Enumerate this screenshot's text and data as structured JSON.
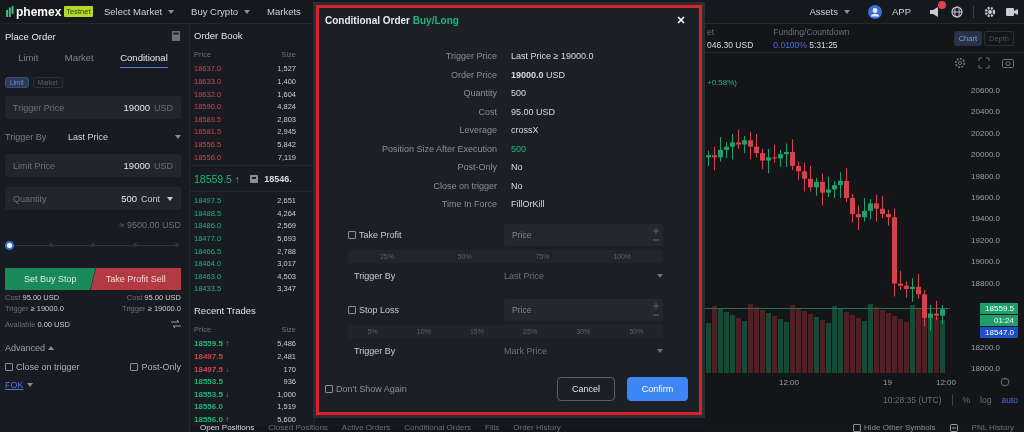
{
  "top_nav": {
    "logo": "phemex",
    "badge": "Testnet",
    "menus": [
      {
        "label": "Select Market",
        "dropdown": true
      },
      {
        "label": "Buy Crypto",
        "dropdown": true
      },
      {
        "label": "Markets",
        "dropdown": false
      }
    ],
    "assets": "Assets",
    "app": "APP"
  },
  "place_order": {
    "title": "Place Order",
    "tabs": [
      {
        "label": "Limit",
        "selected": false
      },
      {
        "label": "Market",
        "selected": false
      },
      {
        "label": "Conditional",
        "selected": true
      }
    ],
    "order_types": [
      {
        "label": "Limit",
        "selected": true
      },
      {
        "label": "Market",
        "selected": false
      }
    ],
    "trigger_price": {
      "label": "Trigger Price",
      "value": "19000",
      "unit": "USD"
    },
    "trigger_by": {
      "label": "Trigger By",
      "value": "Last Price"
    },
    "limit_price": {
      "label": "Limit Price",
      "value": "19000",
      "unit": "USD"
    },
    "quantity": {
      "label": "Quantity",
      "value": "500",
      "unit": "Cont"
    },
    "estimate": "≈ 9500.00 USD",
    "slider": {
      "level": 0
    },
    "buy_button": "Set Buy Stop",
    "sell_button": "Take Profit Sell",
    "buy_summary": [
      {
        "label": "Cost",
        "value": "95.00 USD"
      },
      {
        "label": "Trigger",
        "value": "≥ 19000.0"
      }
    ],
    "sell_summary": [
      {
        "label": "Cost",
        "value": "95.00 USD"
      },
      {
        "label": "Trigger",
        "value": "≥ 19000.0"
      }
    ],
    "available": {
      "label": "Available",
      "value": "0.00 USD"
    },
    "advanced": "Advanced",
    "options": [
      {
        "label": "Close on trigger",
        "checked": false
      },
      {
        "label": "Post-Only",
        "checked": false
      }
    ],
    "time_in_force": "FOK"
  },
  "order_book": {
    "title": "Order Book",
    "columns": [
      "Price",
      "Size"
    ],
    "asks": [
      {
        "price": "18637.0",
        "size": "1,527"
      },
      {
        "price": "18633.0",
        "size": "1,400"
      },
      {
        "price": "18632.0",
        "size": "1,604"
      },
      {
        "price": "18590.0",
        "size": "4,824"
      },
      {
        "price": "18589.5",
        "size": "2,803"
      },
      {
        "price": "18581.5",
        "size": "2,945"
      },
      {
        "price": "18556.5",
        "size": "5,842"
      },
      {
        "price": "18556.0",
        "size": "7,119"
      }
    ],
    "last_price": "18559.5 ↑",
    "mark_price": "18546.",
    "bids": [
      {
        "price": "18497.5",
        "size": "2,651"
      },
      {
        "price": "18488.5",
        "size": "4,264"
      },
      {
        "price": "18486.0",
        "size": "2,569"
      },
      {
        "price": "18477.0",
        "size": "5,693"
      },
      {
        "price": "18466.5",
        "size": "2,788"
      },
      {
        "price": "18464.0",
        "size": "3,017"
      },
      {
        "price": "18463.0",
        "size": "4,503"
      },
      {
        "price": "18433.5",
        "size": "3,347"
      }
    ]
  },
  "recent_trades": {
    "title": "Recent Trades",
    "columns": [
      "Price",
      "Size"
    ],
    "rows": [
      {
        "price": "18559.5 ↑",
        "size": "5,486",
        "color": "#1fb57a"
      },
      {
        "price": "18497.5",
        "size": "2,481",
        "color": "#d1434f"
      },
      {
        "price": "18497.5 ↓",
        "size": "170",
        "color": "#d1434f"
      },
      {
        "price": "18553.5",
        "size": "936",
        "color": "#1fb57a"
      },
      {
        "price": "18553.5 ↓",
        "size": "1,000",
        "color": "#1fb57a"
      },
      {
        "price": "18556.0",
        "size": "1,519",
        "color": "#1fb57a"
      },
      {
        "price": "18556.0 ↑",
        "size": "5,600",
        "color": "#1fb57a"
      }
    ]
  },
  "ticker": {
    "stat": {
      "label": "et",
      "value": "046.30 USD"
    },
    "funding": {
      "label": "Funding/Countdown",
      "rate": "0.0100%",
      "countdown": "5:31:25"
    },
    "views": [
      {
        "label": "Chart",
        "selected": true
      },
      {
        "label": "Depth",
        "selected": false
      }
    ]
  },
  "chart": {
    "change": "+0.58%)",
    "chart_data": {
      "type": "candlestick",
      "ylim": [
        18000,
        20600
      ],
      "yticks": [
        {
          "value": 20600,
          "label": "20600.0"
        },
        {
          "value": 20400,
          "label": "20400.0"
        },
        {
          "value": 20200,
          "label": "20200.0"
        },
        {
          "value": 20000,
          "label": "20000.0"
        },
        {
          "value": 19800,
          "label": "19800.0"
        },
        {
          "value": 19600,
          "label": "19600.0"
        },
        {
          "value": 19400,
          "label": "19400.0"
        },
        {
          "value": 19200,
          "label": "19200.0"
        },
        {
          "value": 19000,
          "label": "19000.0"
        },
        {
          "value": 18800,
          "label": "18800.0"
        },
        {
          "value": 18200,
          "label": "18200.0"
        },
        {
          "value": 18000,
          "label": "18000.0"
        }
      ],
      "categories": [
        null,
        null,
        null,
        null,
        null,
        null,
        null,
        null,
        null,
        null,
        null,
        null,
        null,
        null,
        null,
        null,
        null,
        null,
        null,
        null,
        null,
        null,
        null,
        null,
        null,
        null,
        null,
        null,
        null,
        null,
        null,
        null,
        null,
        null,
        null,
        null,
        null,
        null,
        null,
        null
      ],
      "ohlc": [
        [
          19980,
          20040,
          19900,
          20000
        ],
        [
          20000,
          20080,
          19860,
          19980
        ],
        [
          19980,
          20170,
          19940,
          20050
        ],
        [
          20050,
          20120,
          19970,
          20080
        ],
        [
          20080,
          20200,
          19960,
          20120
        ],
        [
          20120,
          20240,
          20060,
          20100
        ],
        [
          20100,
          20180,
          20020,
          20140
        ],
        [
          20140,
          20220,
          19960,
          20080
        ],
        [
          20080,
          20200,
          19980,
          20020
        ],
        [
          20020,
          20060,
          19870,
          19950
        ],
        [
          19950,
          20060,
          19830,
          19980
        ],
        [
          19980,
          20100,
          19930,
          19970
        ],
        [
          19970,
          20050,
          19890,
          20010
        ],
        [
          20010,
          20110,
          19890,
          20030
        ],
        [
          20030,
          20150,
          19860,
          19900
        ],
        [
          19900,
          19940,
          19770,
          19850
        ],
        [
          19850,
          19930,
          19660,
          19780
        ],
        [
          19780,
          19900,
          19660,
          19700
        ],
        [
          19700,
          19790,
          19620,
          19750
        ],
        [
          19750,
          19830,
          19530,
          19650
        ],
        [
          19650,
          19800,
          19610,
          19680
        ],
        [
          19680,
          19760,
          19600,
          19720
        ],
        [
          19720,
          19840,
          19600,
          19760
        ],
        [
          19760,
          19880,
          19560,
          19600
        ],
        [
          19600,
          19640,
          19370,
          19450
        ],
        [
          19450,
          19530,
          19300,
          19420
        ],
        [
          19420,
          19600,
          19380,
          19480
        ],
        [
          19480,
          19590,
          19400,
          19550
        ],
        [
          19550,
          19630,
          19380,
          19500
        ],
        [
          19500,
          19620,
          19410,
          19450
        ],
        [
          19450,
          19490,
          19340,
          19420
        ],
        [
          19420,
          19500,
          18680,
          18800
        ],
        [
          18800,
          18920,
          18740,
          18780
        ],
        [
          18780,
          18820,
          18670,
          18750
        ],
        [
          18750,
          18850,
          18630,
          18770
        ],
        [
          18770,
          18890,
          18660,
          18700
        ],
        [
          18700,
          18740,
          18400,
          18480
        ],
        [
          18480,
          18600,
          18360,
          18520
        ],
        [
          18520,
          18640,
          18460,
          18500
        ],
        [
          18500,
          18600,
          18420,
          18560
        ]
      ]
    },
    "price_tags": [
      {
        "label": "18559.5",
        "color": "#1e9e6a"
      },
      {
        "label": "01:24",
        "color": "#1e9e6a"
      },
      {
        "label": "18547.0",
        "color": "#1f4fc4"
      }
    ],
    "time_axis": [
      "12:00",
      "19",
      "12:00"
    ],
    "clock": "10:28:35 (UTC)",
    "scales": [
      {
        "label": "%",
        "selected": false
      },
      {
        "label": "log",
        "selected": false
      },
      {
        "label": "auto",
        "selected": true
      }
    ]
  },
  "bottom_tabs": [
    {
      "label": "Open Positions",
      "selected": true
    },
    {
      "label": "Closed Positions",
      "selected": false
    },
    {
      "label": "Active Orders",
      "selected": false
    },
    {
      "label": "Conditional Orders",
      "selected": false
    },
    {
      "label": "Fills",
      "selected": false
    },
    {
      "label": "Order History",
      "selected": false
    }
  ],
  "hide_other_symbols": {
    "label": "Hide Other Symbols",
    "checked": false
  },
  "pnl_history": "PNL History",
  "dialog": {
    "title": "Conditional Order",
    "side": "Buy/Long",
    "details": [
      {
        "label": "Trigger Price",
        "value": "Last Price ≥ 19000.0",
        "highlight": false
      },
      {
        "label": "Order Price",
        "value": "**19000.0** USD",
        "highlight": false
      },
      {
        "label": "Quantity",
        "value": "500",
        "highlight": false
      },
      {
        "label": "Cost",
        "value": "95.00 USD",
        "highlight": false
      },
      {
        "label": "Leverage",
        "value": "crossX",
        "highlight": false
      },
      {
        "label": "Position Size After Execution",
        "value": "500",
        "highlight": true
      },
      {
        "label": "Post-Only",
        "value": "No",
        "highlight": false
      },
      {
        "label": "Close on trigger",
        "value": "No",
        "highlight": false
      },
      {
        "label": "Time In Force",
        "value": "FillOrKill",
        "highlight": false
      }
    ],
    "sections": [
      {
        "label": "Take Profit",
        "checked": false,
        "placeholder": "Price",
        "percents": [
          "25%",
          "50%",
          "75%",
          "100%"
        ],
        "trigger_label": "Trigger By",
        "trigger_value": "Last Price"
      },
      {
        "label": "Stop Loss",
        "checked": false,
        "placeholder": "Price",
        "percents": [
          "5%",
          "10%",
          "15%",
          "25%",
          "30%",
          "50%"
        ],
        "trigger_label": "Trigger By",
        "trigger_value": "Mark Price"
      }
    ],
    "dont_show": {
      "label": "Don't Show Again",
      "checked": false
    },
    "cancel": "Cancel",
    "confirm": "Confirm"
  }
}
